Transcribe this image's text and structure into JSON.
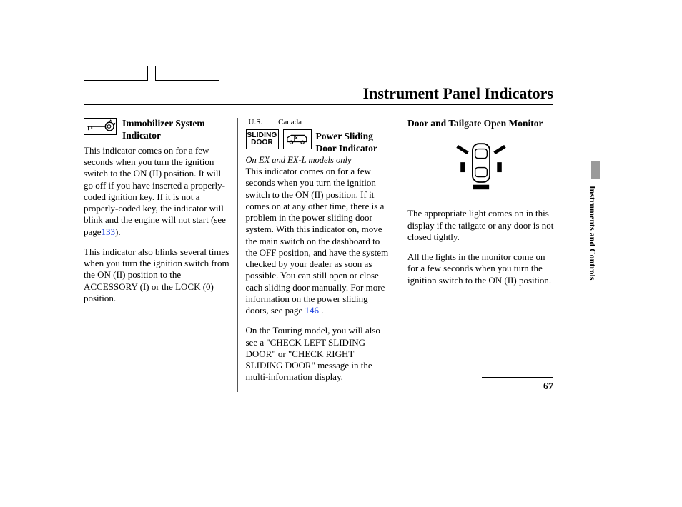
{
  "page_title": "Instrument Panel Indicators",
  "side_section": "Instruments and Controls",
  "page_number": "67",
  "col1": {
    "heading": "Immobilizer System Indicator",
    "p1a": "This indicator comes on for a few seconds when you turn the ignition switch to the ON (II) position. It will go off if you have inserted a properly-coded ignition key. If it is not a properly-coded key, the indicator will blink and the engine will not start (see page",
    "p1_link": "133",
    "p1b": ").",
    "p2": "This indicator also blinks several times when you turn the ignition switch from the ON (II) position to the ACCESSORY (I) or the LOCK (0) position."
  },
  "col2": {
    "label_us": "U.S.",
    "label_ca": "Canada",
    "sliding_line1": "SLIDING",
    "sliding_line2": "DOOR",
    "heading": "Power Sliding Door Indicator",
    "subnote": "On EX and EX-L models only",
    "p1a": "This indicator comes on for a few seconds when you turn the ignition switch to the ON (II) position. If it comes on at any other time, there is a problem in the power sliding door system. With this indicator on, move the main switch on the dashboard to the OFF position, and have the system checked by your dealer as soon as possible. You can still open or close each sliding door manually. For more information on the power sliding doors, see page ",
    "p1_link": "146",
    "p1b": " .",
    "p2": "On the Touring model, you will also see a \"CHECK LEFT SLIDING DOOR\" or \"CHECK RIGHT SLIDING DOOR\" message in the multi-information display."
  },
  "col3": {
    "heading": "Door and Tailgate Open Monitor",
    "p1": "The appropriate light comes on in this display if the tailgate or any door is not closed tightly.",
    "p2": "All the lights in the monitor come on for a few seconds when you turn the ignition switch to the ON (II) position."
  }
}
